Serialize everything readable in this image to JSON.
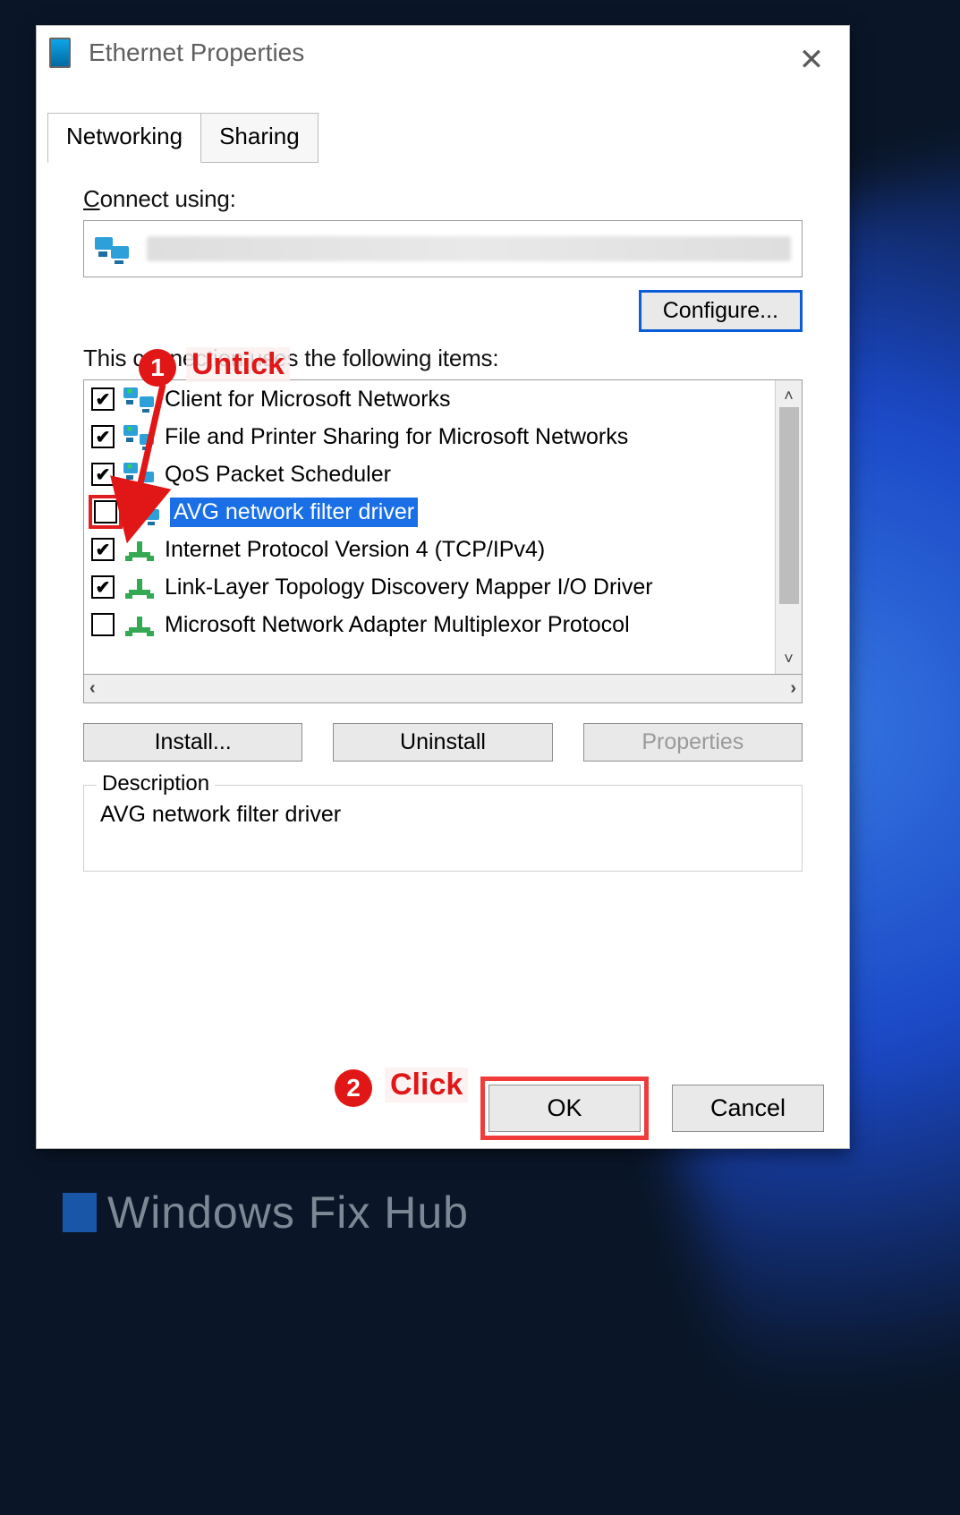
{
  "dialog": {
    "title": "Ethernet Properties",
    "tabs": [
      "Networking",
      "Sharing"
    ],
    "active_tab": 0,
    "connect_using_label": "Connect using:",
    "adapter_name": "",
    "configure_label": "Configure...",
    "items_header": "This connection uses the following items:",
    "items": [
      {
        "checked": true,
        "icon": "net",
        "label": "Client for Microsoft Networks"
      },
      {
        "checked": true,
        "icon": "net",
        "label": "File and Printer Sharing for Microsoft Networks"
      },
      {
        "checked": true,
        "icon": "net",
        "label": "QoS Packet Scheduler"
      },
      {
        "checked": false,
        "icon": "net",
        "label": "AVG network filter driver",
        "selected": true,
        "highlight_cb": true
      },
      {
        "checked": true,
        "icon": "proto",
        "label": "Internet Protocol Version 4 (TCP/IPv4)"
      },
      {
        "checked": true,
        "icon": "proto",
        "label": "Link-Layer Topology Discovery Mapper I/O Driver"
      },
      {
        "checked": false,
        "icon": "proto",
        "label": "Microsoft Network Adapter Multiplexor Protocol"
      }
    ],
    "buttons": {
      "install": "Install...",
      "uninstall": "Uninstall",
      "properties": "Properties"
    },
    "description_legend": "Description",
    "description_text": "AVG network filter driver",
    "ok_label": "OK",
    "cancel_label": "Cancel"
  },
  "annotations": {
    "step1_num": "1",
    "step1_text": "Untick",
    "step2_num": "2",
    "step2_text": "Click"
  },
  "watermark": "Windows Fix Hub"
}
